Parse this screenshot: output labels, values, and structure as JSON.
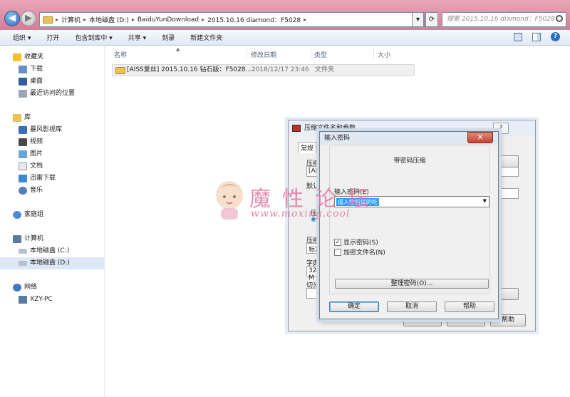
{
  "address": {
    "breadcrumbs": [
      "计算机",
      "本地磁盘 (D:)",
      "BaiduYunDownload",
      "2015.10.16  diamond：F5028"
    ],
    "search_placeholder": "搜索 2015.10.16  diamond：F5028"
  },
  "toolbar": {
    "items": [
      "组织 ▾",
      "打开",
      "包含到库中 ▾",
      "共享 ▾",
      "刻录",
      "新建文件夹"
    ]
  },
  "nav": {
    "favorites": {
      "label": "收藏夹",
      "items": [
        "下载",
        "桌面",
        "最近访问的位置"
      ]
    },
    "library": {
      "label": "库",
      "items": [
        "暴风影视库",
        "视频",
        "图片",
        "文档",
        "迅雷下载",
        "音乐"
      ]
    },
    "homegroup": "家庭组",
    "computer": {
      "label": "计算机",
      "items": [
        "本地磁盘 (C:)",
        "本地磁盘 (D:)"
      ]
    },
    "network": {
      "label": "网络",
      "items": [
        "XZY-PC"
      ]
    }
  },
  "columns": [
    "名称",
    "修改日期",
    "类型",
    "大小"
  ],
  "files": [
    {
      "name": "[AISS爱丝] 2015.10.16 钻石版：F5028...",
      "date": "2018/12/17 23:46",
      "type": "文件夹"
    }
  ],
  "back_dialog": {
    "title": "压缩文件名和参数",
    "tab": "常规",
    "fragments": [
      "压缩",
      "[AISS",
      "默认",
      "压缩",
      "标准",
      "字典",
      "32 M",
      "切分",
      "压",
      "◉"
    ],
    "buttons": [
      "确定",
      "取消",
      "帮助"
    ],
    "help_glyph": "?"
  },
  "password_dialog": {
    "title": "输入密码",
    "close_glyph": "✕",
    "heading": "带密码压缩",
    "password_label": "输入密码(E)",
    "password_value": "成人性错误的吃",
    "show_password": {
      "label": "显示密码(S)",
      "checked": true
    },
    "encrypt_names": {
      "label": "加密文件名(N)",
      "checked": false
    },
    "organize_button": "整理密码(O)...",
    "ok_button": "确定",
    "cancel_button": "取消",
    "help_button": "帮助"
  },
  "watermark": {
    "title": "魔性论坛",
    "url": "www.moxing.cool"
  }
}
